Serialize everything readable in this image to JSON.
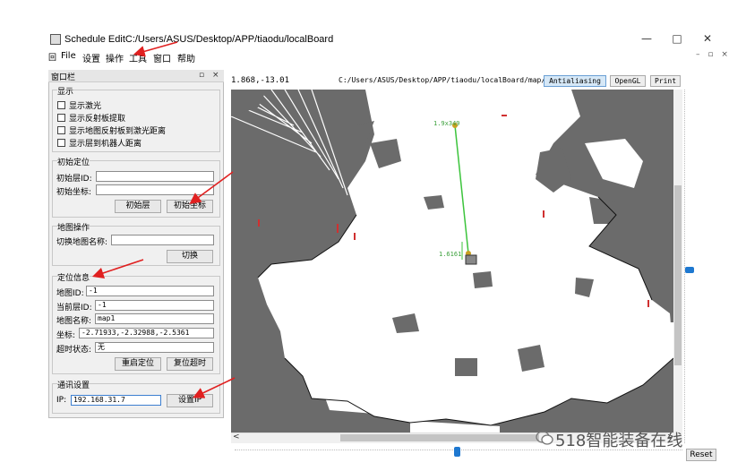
{
  "window": {
    "title": "Schedule EditC:/Users/ASUS/Desktop/APP/tiaodu/localBoard",
    "minimize_glyph": "—",
    "maximize_glyph": "□",
    "close_glyph": "✕"
  },
  "menu": {
    "system_icon": "回",
    "items": [
      "File",
      "设置",
      "操作",
      "工具",
      "窗口",
      "帮助"
    ],
    "right_glyphs": "– ▫ ×"
  },
  "panel": {
    "title": "窗口栏",
    "header_glyphs": "▫ ×",
    "display": {
      "title": "显示",
      "checkboxes": [
        "显示激光",
        "显示反射板提取",
        "显示地图反射板到激光距离",
        "显示层到机器人距离"
      ]
    },
    "init_locate": {
      "title": "初始定位",
      "layer_id_label": "初始层ID:",
      "layer_id_value": "",
      "coord_label": "初始坐标:",
      "coord_value": "",
      "init_layer_button": "初始层",
      "init_coord_button": "初始坐标"
    },
    "map_ops": {
      "title": "地图操作",
      "switch_label": "切换地图名称:",
      "switch_value": "",
      "switch_button": "切换"
    },
    "locate_info": {
      "title": "定位信息",
      "map_id_label": "地图ID:",
      "map_id_value": "-1",
      "cur_layer_label": "当前层ID:",
      "cur_layer_value": "-1",
      "map_name_label": "地图名称:",
      "map_name_value": "map1",
      "coord_label": "坐标:",
      "coord_value": "-2.71933,-2.32988,-2.5361",
      "timeout_label": "超时状态:",
      "timeout_value": "无",
      "restart_button": "重启定位",
      "reset_timeout_button": "复位超时"
    },
    "comm": {
      "title": "通讯设置",
      "ip_label": "IP:",
      "ip_value": "192.168.31.7",
      "set_ip_button": "设置IP"
    }
  },
  "map": {
    "coord_readout": "1.868,-13.01",
    "path": "C:/Users/ASUS/Desktop/APP/tiaodu/localBoard/map/",
    "antialias_label": "Antialiasing",
    "opengl_label": "OpenGL",
    "print_label": "Print",
    "reset_label": "Reset",
    "node_label_top": "1.9x349",
    "node_label_bottom": "1.6161",
    "scroll_left": "<",
    "scroll_right": ">"
  },
  "colors": {
    "annotation_arrow": "#e02020",
    "path_line": "#3cc43c",
    "map_free": "#ffffff",
    "map_unknown": "#6b6b6b",
    "accent": "#1e78d0"
  },
  "watermark": "518智能装备在线"
}
